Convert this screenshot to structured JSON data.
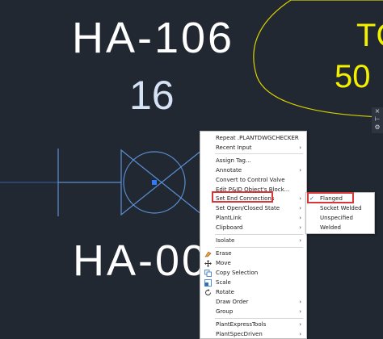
{
  "drawing": {
    "tag_top": "HA-106",
    "number": "16",
    "tag_bottom": "HA-00",
    "yellow_top": "TC",
    "yellow_number": "50",
    "side_strip": [
      "×",
      "⊢",
      "⚙"
    ]
  },
  "context_menu": {
    "items": [
      {
        "label": "Repeat .PLANTDWGCHECKER",
        "arrow": "",
        "icon": ""
      },
      {
        "label": "Recent Input",
        "arrow": "›",
        "icon": ""
      },
      {
        "label": "Assign Tag...",
        "arrow": "",
        "icon": ""
      },
      {
        "label": "Annotate",
        "arrow": "›",
        "icon": ""
      },
      {
        "label": "Convert to Control Valve",
        "arrow": "",
        "icon": ""
      },
      {
        "label": "Edit P&ID Object's Block...",
        "arrow": "",
        "icon": ""
      },
      {
        "label": "Set End Connections",
        "arrow": "›",
        "icon": ""
      },
      {
        "label": "Set Open/Closed State",
        "arrow": "›",
        "icon": ""
      },
      {
        "label": "PlantLink",
        "arrow": "›",
        "icon": ""
      },
      {
        "label": "Clipboard",
        "arrow": "›",
        "icon": ""
      },
      {
        "label": "Isolate",
        "arrow": "›",
        "icon": ""
      },
      {
        "label": "Erase",
        "arrow": "",
        "icon": "eraser-icon"
      },
      {
        "label": "Move",
        "arrow": "",
        "icon": "move-icon"
      },
      {
        "label": "Copy Selection",
        "arrow": "",
        "icon": "copy-icon"
      },
      {
        "label": "Scale",
        "arrow": "",
        "icon": "scale-icon"
      },
      {
        "label": "Rotate",
        "arrow": "",
        "icon": "rotate-icon"
      },
      {
        "label": "Draw Order",
        "arrow": "›",
        "icon": ""
      },
      {
        "label": "Group",
        "arrow": "›",
        "icon": ""
      },
      {
        "label": "PlantExpressTools",
        "arrow": "›",
        "icon": ""
      },
      {
        "label": "PlantSpecDriven",
        "arrow": "›",
        "icon": ""
      }
    ]
  },
  "submenu": {
    "items": [
      {
        "label": "Flanged",
        "checked": "✓"
      },
      {
        "label": "Socket Welded",
        "checked": ""
      },
      {
        "label": "Unspecified",
        "checked": ""
      },
      {
        "label": "Welded",
        "checked": ""
      }
    ]
  },
  "colors": {
    "background": "#212831",
    "valve_line": "#5b8fd6",
    "yellow": "#f3f000",
    "highlight": "#d9363a"
  }
}
